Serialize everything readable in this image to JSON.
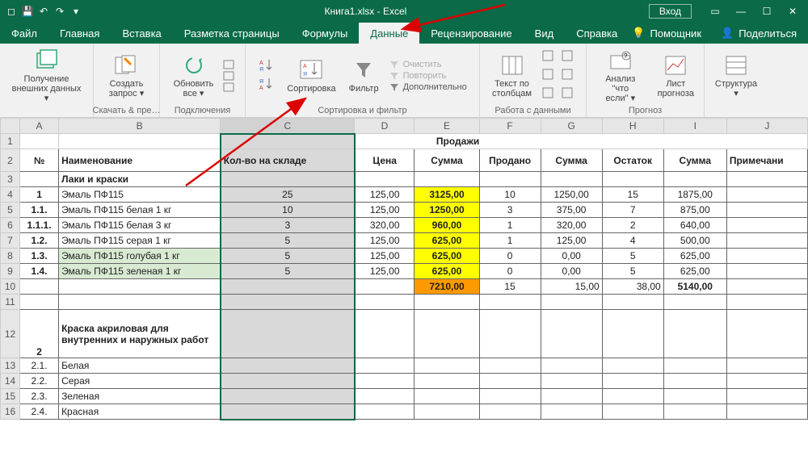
{
  "titlebar": {
    "filename": "Книга1.xlsx - Excel",
    "login": "Вход"
  },
  "tabs": [
    "Файл",
    "Главная",
    "Вставка",
    "Разметка страницы",
    "Формулы",
    "Данные",
    "Рецензирование",
    "Вид",
    "Справка"
  ],
  "active_tab": "Данные",
  "assist": "Помощник",
  "share": "Поделиться",
  "ribbon": {
    "g1": {
      "btn": "Получение\nвнешних данных ▾",
      "label": ""
    },
    "g2": {
      "btn": "Создать\nзапрос ▾",
      "label": "Скачать & пре…"
    },
    "g3": {
      "btn": "Обновить\nвсе ▾",
      "label": "Подключения"
    },
    "g4": {
      "btn": "Сортировка",
      "label": "Сортировка и фильтр",
      "filter": "Фильтр",
      "items": [
        "Очистить",
        "Повторить",
        "Дополнительно"
      ]
    },
    "g5": {
      "btn": "Текст по\nстолбцам",
      "label": "Работа с данными"
    },
    "g6": {
      "btn1": "Анализ \"что\nесли\" ▾",
      "btn2": "Лист\nпрогноза",
      "label": "Прогноз"
    },
    "g7": {
      "btn": "Структура\n▾"
    }
  },
  "cols": [
    "A",
    "B",
    "C",
    "D",
    "E",
    "F",
    "G",
    "H",
    "I",
    "J"
  ],
  "header": {
    "title": "Продажи",
    "h": [
      "№",
      "Наименование",
      "Кол-во на складе",
      "Цена",
      "Сумма",
      "Продано",
      "Сумма",
      "Остаток",
      "Сумма",
      "Примечани"
    ]
  },
  "sec1": "Лаки и  краски",
  "rows": [
    {
      "r": 4,
      "no": "1",
      "name": "Эмаль ПФ115",
      "qty": "25",
      "price": "125,00",
      "sum": "3125,00",
      "sold": "10",
      "ssum": "1250,00",
      "rem": "15",
      "rsum": "1875,00"
    },
    {
      "r": 5,
      "no": "1.1.",
      "name": "Эмаль ПФ115 белая 1 кг",
      "qty": "10",
      "price": "125,00",
      "sum": "1250,00",
      "sold": "3",
      "ssum": "375,00",
      "rem": "7",
      "rsum": "875,00"
    },
    {
      "r": 6,
      "no": "1.1.1.",
      "name": "Эмаль ПФ115 белая 3 кг",
      "qty": "3",
      "price": "320,00",
      "sum": "960,00",
      "sold": "1",
      "ssum": "320,00",
      "rem": "2",
      "rsum": "640,00"
    },
    {
      "r": 7,
      "no": "1.2.",
      "name": "Эмаль ПФ115 серая 1 кг",
      "qty": "5",
      "price": "125,00",
      "sum": "625,00",
      "sold": "1",
      "ssum": "125,00",
      "rem": "4",
      "rsum": "500,00"
    },
    {
      "r": 8,
      "no": "1.3.",
      "name": "Эмаль ПФ115 голубая 1 кг",
      "qty": "5",
      "price": "125,00",
      "sum": "625,00",
      "sold": "0",
      "ssum": "0,00",
      "rem": "5",
      "rsum": "625,00"
    },
    {
      "r": 9,
      "no": "1.4.",
      "name": "Эмаль ПФ115 зеленая 1 кг",
      "qty": "5",
      "price": "125,00",
      "sum": "625,00",
      "sold": "0",
      "ssum": "0,00",
      "rem": "5",
      "rsum": "625,00"
    }
  ],
  "total": {
    "r": 10,
    "sum": "7210,00",
    "sold": "15",
    "ssum": "15,00",
    "rem": "38,00",
    "rsum": "5140,00"
  },
  "sec2": {
    "no": "2",
    "name": "Краска акриловая для внутренних и наружных работ"
  },
  "rows2": [
    {
      "r": 13,
      "no": "2.1.",
      "name": "Белая"
    },
    {
      "r": 14,
      "no": "2.2.",
      "name": "Серая"
    },
    {
      "r": 15,
      "no": "2.3.",
      "name": "Зеленая"
    },
    {
      "r": 16,
      "no": "2.4.",
      "name": "Красная"
    }
  ]
}
